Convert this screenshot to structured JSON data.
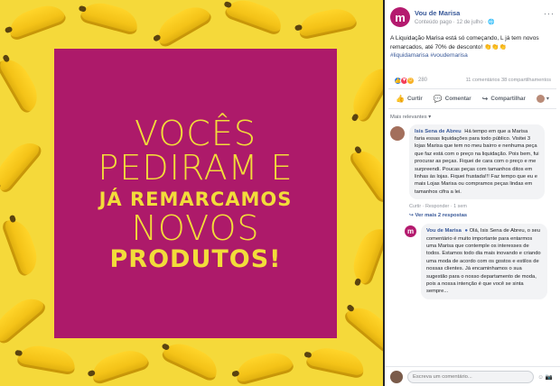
{
  "poster": {
    "line1": "VOCÊS",
    "line2": "PEDIRAM E",
    "line3": "JÁ REMARCAMOS",
    "line4": "NOVOS",
    "line5": "PRODUTOS!"
  },
  "post": {
    "avatar_letter": "m",
    "page_name": "Vou de Marisa",
    "meta": "Conteúdo pago · 12 de julho · 🌐",
    "text": "A Liquidação Marisa está só começando, L já tem novos remarcados, até 70% de desconto! 👏👏👏",
    "hashtags": "#liquidamarisa #voudemarisa",
    "reaction_count": "280",
    "stats": "11 comentários  38 compartilhamentos"
  },
  "actions": {
    "like": "Curtir",
    "comment": "Comentar",
    "share": "Compartilhar"
  },
  "comments": {
    "sort_label": "Mais relevantes ▾",
    "first": {
      "author": "Isis Sena de Abreu",
      "text": "Há tempo em que a Marisa faria essas liquidações para todo público. Visitei 3 lojas Marisa que tem no meu bairro e nenhuma peça que faz está com o preço na liquidação. Pois bem, fui procurar as peças. Fiquei de cara com o preço e me surpreendi. Poucas peças com tamanhos ditos em linhas às lojas. Fiquei frustada!!! Faz tempo que eu e mais Lojas Marisa ou compramos peças lindas em tamanhos cifra a lei.",
      "actions": "Curtir · Responder · 1 sem",
      "replies": "↪ Ver mais 2 respostas"
    },
    "reply": {
      "avatar_letter": "m",
      "author": "Vou de Marisa",
      "text": "Olá, Isis Sena de Abreu, o seu comentário é muito importante para entarmos uma Marisa que contemple os interesses de todos. Estamos todo dia mais inovando e criando uma moda de acordo com os gostos e estilos de nossas clientes. Já encaminhamos o sua sugestão para o nosso departamento de moda, pois a nossa intenção é que você se sinta sempre..."
    },
    "write_placeholder": "Escreva um comentário..."
  }
}
